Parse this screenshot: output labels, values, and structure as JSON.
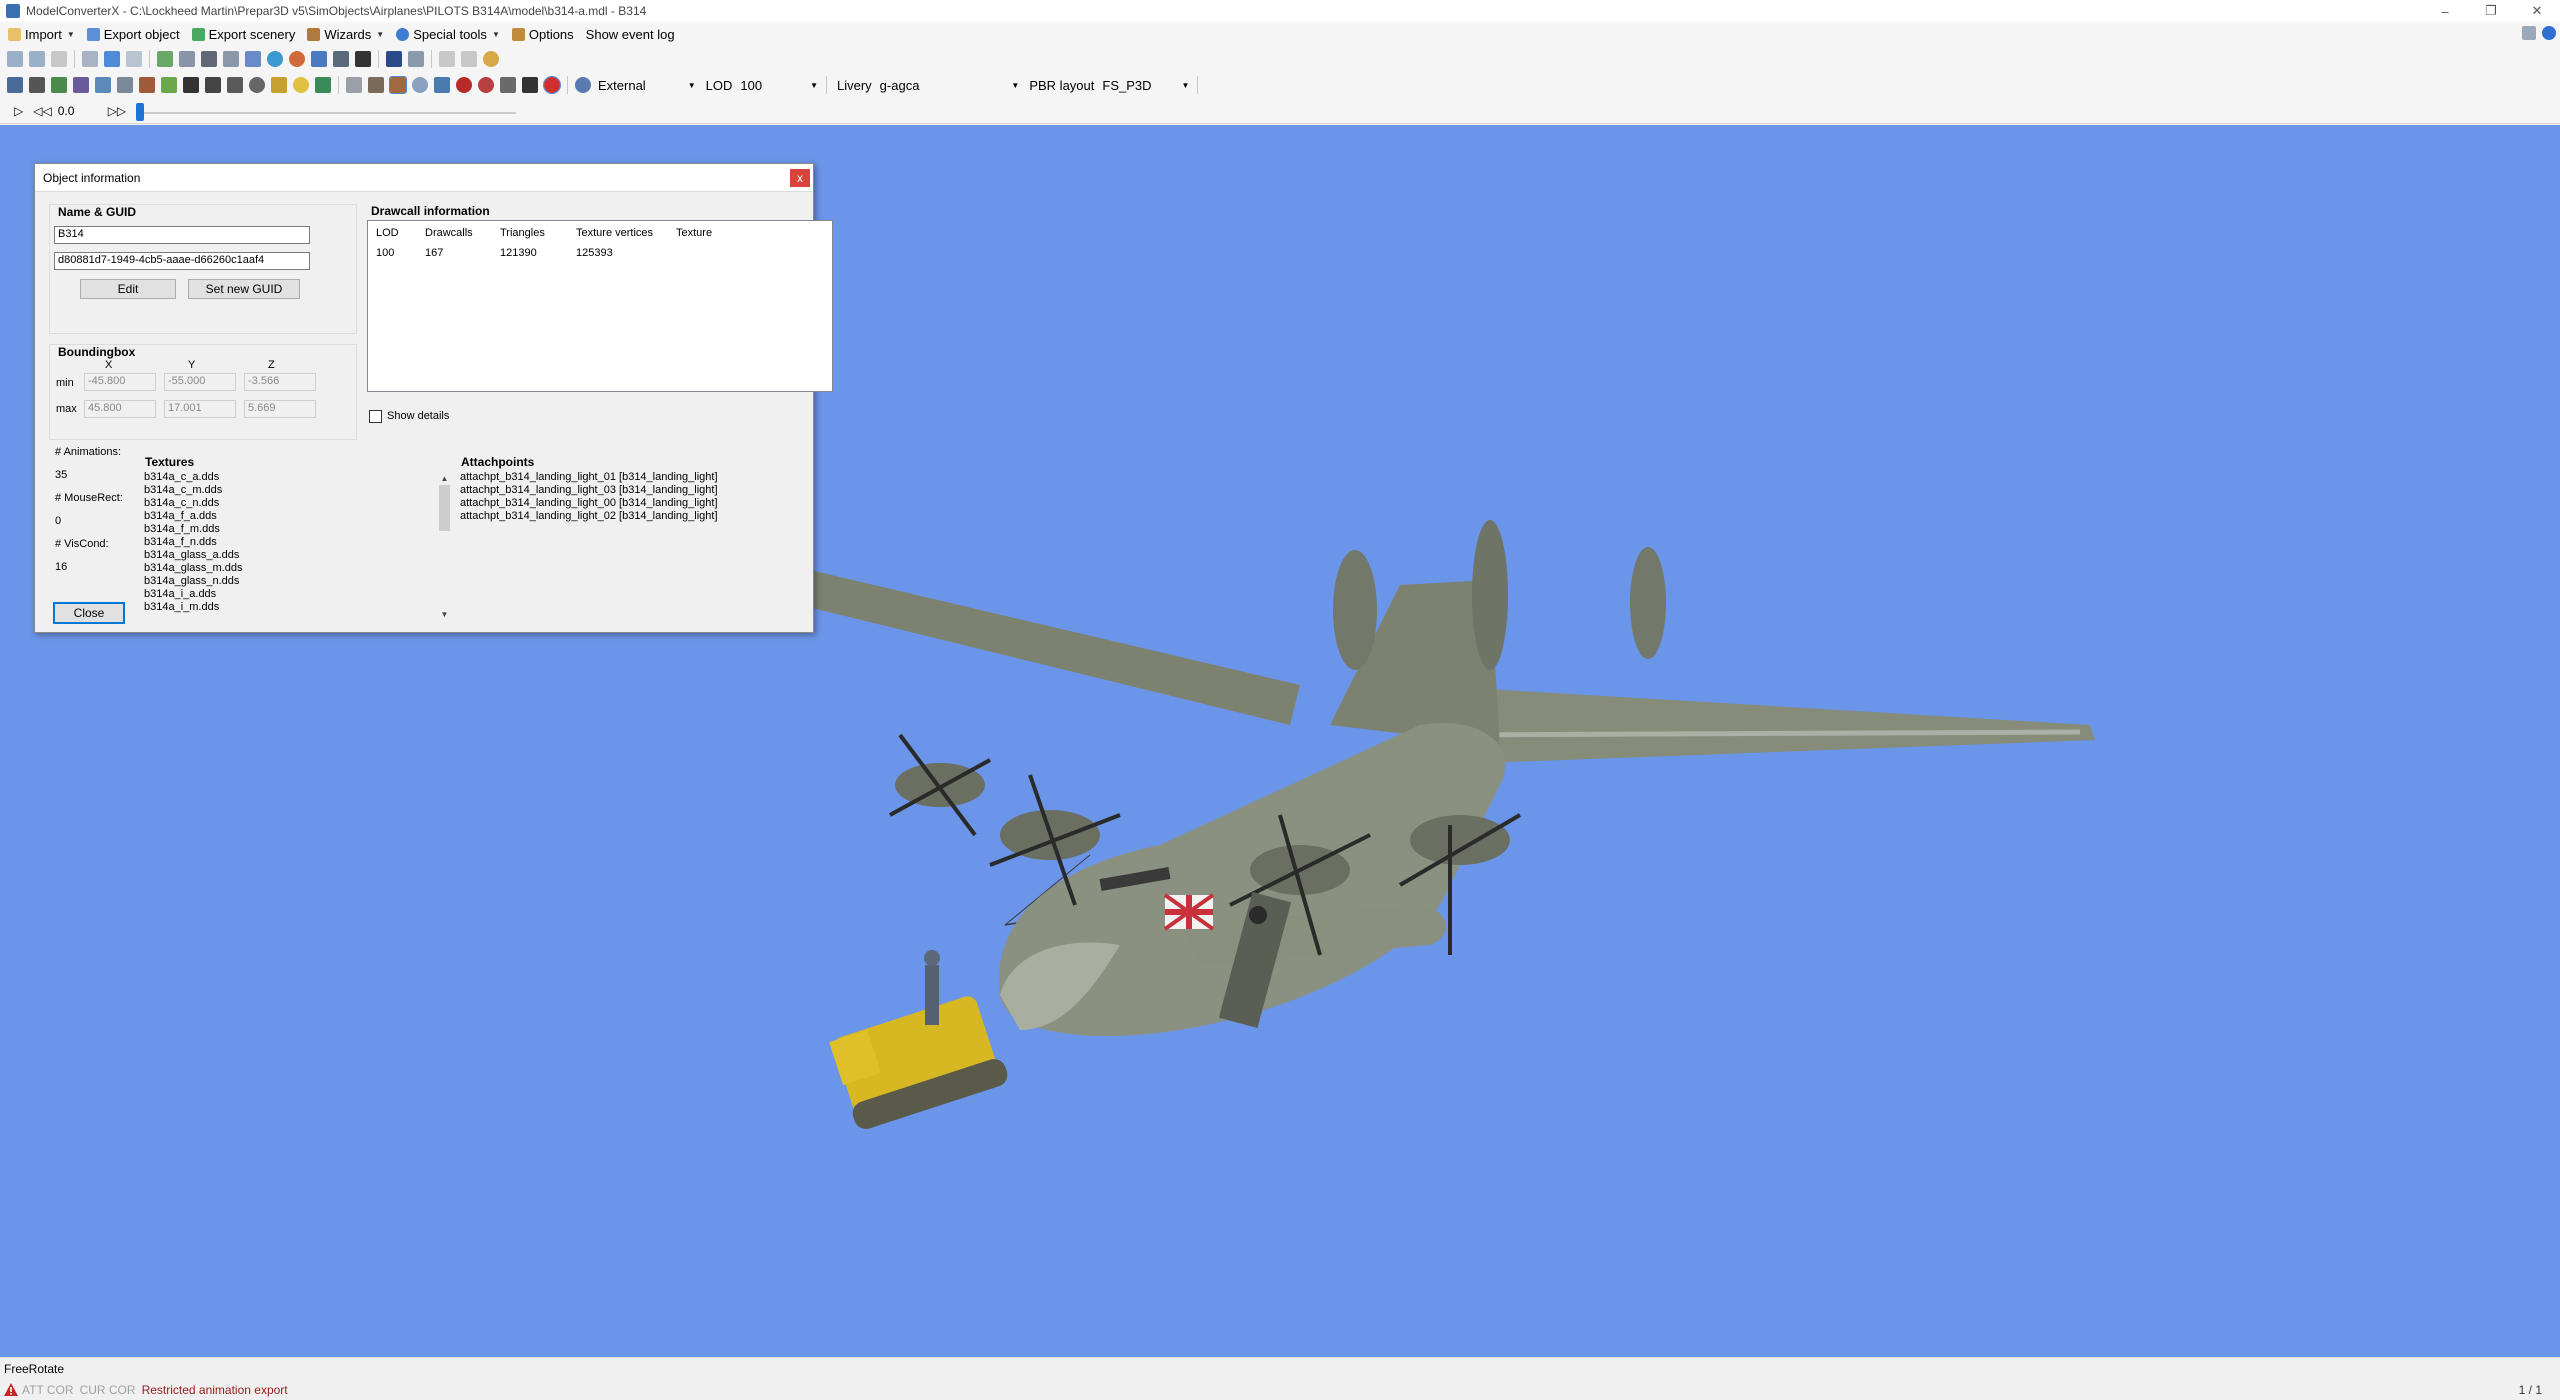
{
  "window": {
    "title": "ModelConverterX - C:\\Lockheed Martin\\Prepar3D v5\\SimObjects\\Airplanes\\PILOTS B314A\\model\\b314-a.mdl - B314",
    "controls": [
      "minimize-icon",
      "restore-icon",
      "close-icon"
    ]
  },
  "menu": {
    "items": [
      {
        "label": "Import",
        "icon": "folder-open-icon",
        "has_dropdown": true
      },
      {
        "label": "Export object",
        "icon": "export-object-icon",
        "has_dropdown": false
      },
      {
        "label": "Export scenery",
        "icon": "export-scenery-icon",
        "has_dropdown": false
      },
      {
        "label": "Wizards",
        "icon": "wizard-icon",
        "has_dropdown": true
      },
      {
        "label": "Special tools",
        "icon": "gear-icon",
        "has_dropdown": true
      },
      {
        "label": "Options",
        "icon": "wrench-icon",
        "has_dropdown": false
      },
      {
        "label": "Show event log",
        "icon": "",
        "has_dropdown": false
      }
    ]
  },
  "toolbar": {
    "view_label": "External",
    "lod_label": "LOD",
    "lod_value": "100",
    "livery_label": "Livery",
    "livery_value": "g-agca",
    "pbr_label": "PBR layout",
    "pbr_value": "FS_P3D"
  },
  "animation_bar": {
    "time": "0.0",
    "progress": 0.0
  },
  "dialog": {
    "title": "Object information",
    "name_guid_title": "Name & GUID",
    "name": "B314",
    "guid": "d80881d7-1949-4cb5-aaae-d66260c1aaf4",
    "edit_label": "Edit",
    "new_guid_label": "Set new GUID",
    "boundingbox_title": "Boundingbox",
    "axes": [
      "X",
      "Y",
      "Z"
    ],
    "min_label": "min",
    "max_label": "max",
    "min": [
      "-45.800",
      "-55.000",
      "-3.566"
    ],
    "max": [
      "45.800",
      "17.001",
      "5.669"
    ],
    "drawcall_title": "Drawcall information",
    "drawcall_columns": [
      "LOD",
      "Drawcalls",
      "Triangles",
      "Texture vertices",
      "Texture"
    ],
    "drawcall_rows": [
      [
        "100",
        "167",
        "121390",
        "125393",
        ""
      ]
    ],
    "show_details_label": "Show details",
    "animations_label": "# Animations:",
    "animations_value": "35",
    "mouserect_label": "# MouseRect:",
    "mouserect_value": "0",
    "viscond_label": "# VisCond:",
    "viscond_value": "16",
    "textures_title": "Textures",
    "textures": [
      "b314a_c_a.dds",
      "b314a_c_m.dds",
      "b314a_c_n.dds",
      "b314a_f_a.dds",
      "b314a_f_m.dds",
      "b314a_f_n.dds",
      "b314a_glass_a.dds",
      "b314a_glass_m.dds",
      "b314a_glass_n.dds",
      "b314a_i_a.dds",
      "b314a_i_m.dds"
    ],
    "attachpoints_title": "Attachpoints",
    "attachpoints": [
      "attachpt_b314_landing_light_01 [b314_landing_light]",
      "attachpt_b314_landing_light_03 [b314_landing_light]",
      "attachpt_b314_landing_light_00 [b314_landing_light]",
      "attachpt_b314_landing_light_02 [b314_landing_light]"
    ],
    "close_label": "Close",
    "close_x": "x"
  },
  "status": {
    "mode": "FreeRotate",
    "att_cor": "ATT COR",
    "cur_cor": "CUR COR",
    "message": "Restricted animation export",
    "pager": "1 / 1"
  },
  "colors": {
    "viewport_bg": "#6b95e8",
    "accent": "#1e73d6",
    "status_error": "#9a1a1a",
    "close_button": "#d9443a"
  }
}
